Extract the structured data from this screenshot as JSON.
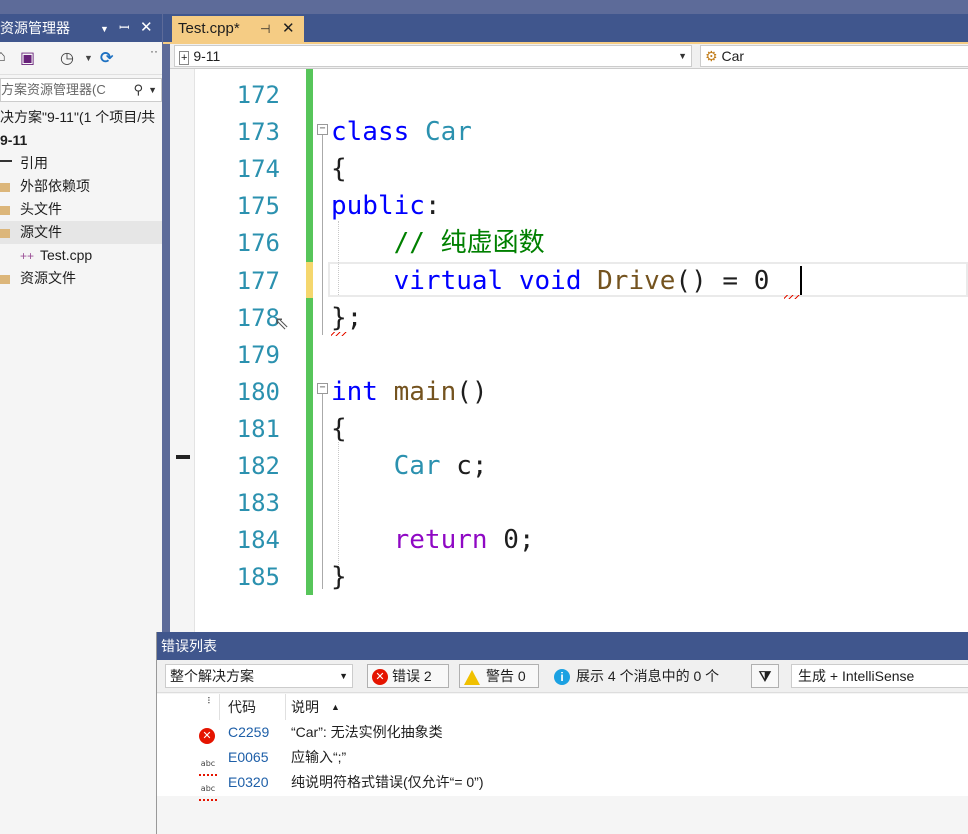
{
  "solution_explorer": {
    "title": "资源管理器",
    "search_placeholder": "方案资源管理器(C",
    "solution_label": "决方案\"9-11\"(1 个项目/共",
    "project": "9-11",
    "items": [
      {
        "label": "引用"
      },
      {
        "label": "外部依赖项"
      },
      {
        "label": "头文件"
      },
      {
        "label": "源文件"
      },
      {
        "label": "Test.cpp"
      },
      {
        "label": "资源文件"
      }
    ]
  },
  "tab": {
    "name": "Test.cpp*"
  },
  "navbar": {
    "scope": "9-11",
    "member": "Car"
  },
  "editor": {
    "line_numbers": [
      "172",
      "173",
      "174",
      "175",
      "176",
      "177",
      "178",
      "179",
      "180",
      "181",
      "182",
      "183",
      "184",
      "185"
    ],
    "lines": [
      [],
      [
        {
          "t": "class",
          "c": "kw"
        },
        {
          "t": " "
        },
        {
          "t": "Car",
          "c": "ty"
        }
      ],
      [
        {
          "t": "{"
        }
      ],
      [
        {
          "t": "public",
          "c": "kw"
        },
        {
          "t": ":"
        }
      ],
      [
        {
          "t": "    "
        },
        {
          "t": "// 纯虚函数",
          "c": "cm"
        }
      ],
      [
        {
          "t": "    "
        },
        {
          "t": "virtual",
          "c": "kw"
        },
        {
          "t": " "
        },
        {
          "t": "void",
          "c": "kw"
        },
        {
          "t": " "
        },
        {
          "t": "Drive",
          "c": "fn"
        },
        {
          "t": "() = 0"
        }
      ],
      [
        {
          "t": "};"
        }
      ],
      [],
      [
        {
          "t": "int",
          "c": "kw"
        },
        {
          "t": " "
        },
        {
          "t": "main",
          "c": "fn"
        },
        {
          "t": "()"
        }
      ],
      [
        {
          "t": "{"
        }
      ],
      [
        {
          "t": "    "
        },
        {
          "t": "Car",
          "c": "ty"
        },
        {
          "t": " c;"
        }
      ],
      [],
      [
        {
          "t": "    "
        },
        {
          "t": "return",
          "c": "ctl"
        },
        {
          "t": " 0;"
        }
      ],
      [
        {
          "t": "}"
        }
      ]
    ]
  },
  "error_list": {
    "title": "错误列表",
    "scope_filter": "整个解决方案",
    "errors_label": "错误 2",
    "warnings_label": "警告 0",
    "messages_label": "展示 4 个消息中的 0 个",
    "build_filter": "生成 + IntelliSense",
    "col_code": "代码",
    "col_desc": "说明",
    "sort_glyph": "▲",
    "rows": [
      {
        "icon": "error",
        "code": "C2259",
        "desc": "“Car”: 无法实例化抽象类"
      },
      {
        "icon": "intellisense",
        "code": "E0065",
        "desc": "应输入“;”"
      },
      {
        "icon": "intellisense",
        "code": "E0320",
        "desc": "纯说明符格式错误(仅允许“= 0”)"
      }
    ]
  }
}
